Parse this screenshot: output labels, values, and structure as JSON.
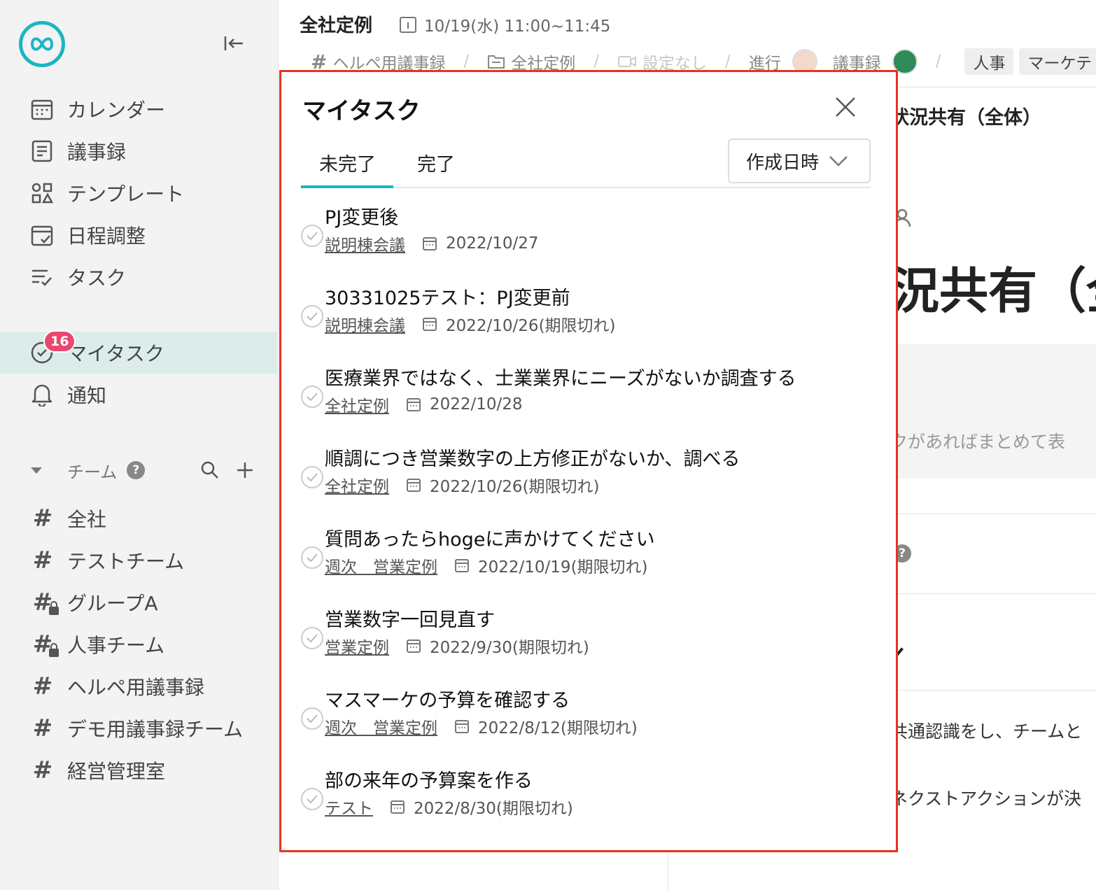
{
  "sidebar": {
    "nav": [
      {
        "label": "カレンダー",
        "icon": "calendar-icon"
      },
      {
        "label": "議事録",
        "icon": "document-icon"
      },
      {
        "label": "テンプレート",
        "icon": "template-icon"
      },
      {
        "label": "日程調整",
        "icon": "schedule-icon"
      },
      {
        "label": "タスク",
        "icon": "task-list-icon"
      }
    ],
    "my_task": {
      "label": "マイタスク",
      "badge": "16"
    },
    "notification": {
      "label": "通知"
    },
    "team_header": {
      "label": "チーム",
      "help": "?"
    },
    "channels": [
      {
        "label": "全社",
        "locked": false
      },
      {
        "label": "テストチーム",
        "locked": false
      },
      {
        "label": "グループA",
        "locked": true
      },
      {
        "label": "人事チーム",
        "locked": true
      },
      {
        "label": "ヘルペ用議事録",
        "locked": false
      },
      {
        "label": "デモ用議事録チーム",
        "locked": false
      },
      {
        "label": "経営管理室",
        "locked": false
      }
    ]
  },
  "header": {
    "title": "全社定例",
    "date": "10/19(水) 11:00~11:45",
    "crumbs": {
      "channel": "ヘルペ用議事録",
      "folder": "全社定例",
      "video": "設定なし",
      "facilitator_label": "進行",
      "minutes_label": "議事録",
      "tag1": "人事",
      "tag2": "マーケテ"
    }
  },
  "background": {
    "section_title": "状況共有（全体）",
    "big_heading": "況共有（全",
    "grey_text": "クがあればまとめて表",
    "line1": "共通認識をし、チームと",
    "line2": "ネクストアクションが決"
  },
  "modal": {
    "title": "マイタスク",
    "tabs": {
      "incomplete": "未完了",
      "complete": "完了"
    },
    "sort": "作成日時",
    "tasks": [
      {
        "name": "PJ変更後",
        "meeting": "説明棟会議",
        "date": "2022/10/27"
      },
      {
        "name": "30331025テスト：PJ変更前",
        "meeting": "説明棟会議",
        "date": "2022/10/26(期限切れ)"
      },
      {
        "name": "医療業界ではなく、士業業界にニーズがないか調査する",
        "meeting": "全社定例",
        "date": "2022/10/28"
      },
      {
        "name": "順調につき営業数字の上方修正がないか、調べる",
        "meeting": "全社定例",
        "date": "2022/10/26(期限切れ)"
      },
      {
        "name": "質問あったらhogeに声かけてください",
        "meeting": "週次　営業定例",
        "date": "2022/10/19(期限切れ)"
      },
      {
        "name": "営業数字一回見直す",
        "meeting": "営業定例",
        "date": "2022/9/30(期限切れ)"
      },
      {
        "name": "マスマーケの予算を確認する",
        "meeting": "週次　営業定例",
        "date": "2022/8/12(期限切れ)"
      },
      {
        "name": "部の来年の予算案を作る",
        "meeting": "テスト",
        "date": "2022/8/30(期限切れ)"
      }
    ]
  },
  "colors": {
    "accent": "#1cb5c4",
    "badge": "#e8476f",
    "highlight_border": "#e8321f"
  }
}
